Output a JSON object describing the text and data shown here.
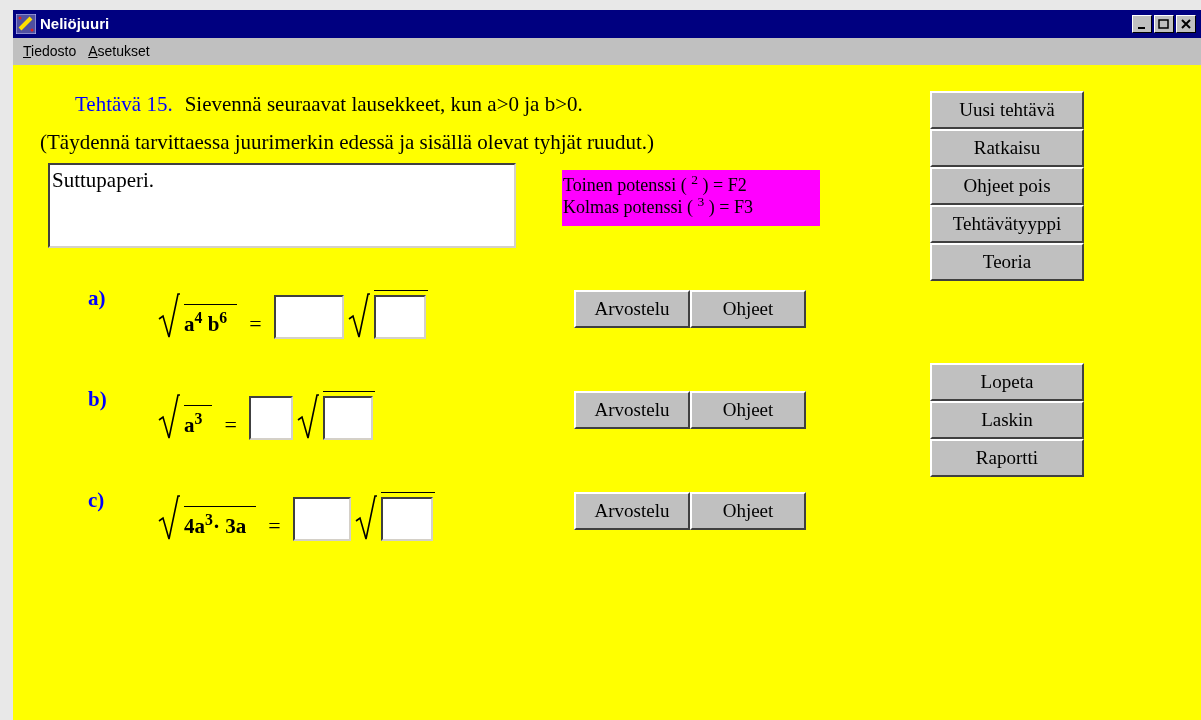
{
  "window": {
    "title": "Neliöjuuri"
  },
  "menu": [
    {
      "label": "Tiedosto",
      "underline_first": true
    },
    {
      "label": "Asetukset",
      "underline_first": true
    }
  ],
  "task": {
    "number_label": "Tehtävä 15.",
    "statement": "Sievennä seuraavat lausekkeet, kun a>0 ja b>0.",
    "instruction": "(Täydennä tarvittaessa juurimerkin edessä ja sisällä olevat tyhjät ruudut.)"
  },
  "scratchpad": {
    "value": "Suttupaperi."
  },
  "hint_box": {
    "lines": [
      "Toinen potenssi ( $^{2}$ ) = F2",
      "Kolmas potenssi ( $^{3}$ ) = F3"
    ]
  },
  "problems": [
    {
      "label": "a)",
      "radicand": "a$^{4}$ b$^{6}$",
      "equals": "=",
      "buttons": [
        "Arvostelu",
        "Ohjeet"
      ]
    },
    {
      "label": "b)",
      "radicand": "a$^{3}$",
      "equals": "=",
      "buttons": [
        "Arvostelu",
        "Ohjeet"
      ]
    },
    {
      "label": "c)",
      "radicand": "4a$^{3}$· 3a",
      "equals": "=",
      "buttons": [
        "Arvostelu",
        "Ohjeet"
      ]
    }
  ],
  "side_buttons": [
    [
      "Uusi tehtävä",
      "Ratkaisu",
      "Ohjeet pois",
      "Tehtävätyyppi",
      "Teoria"
    ],
    [
      "Lopeta",
      "Laskin",
      "Raportti"
    ]
  ]
}
